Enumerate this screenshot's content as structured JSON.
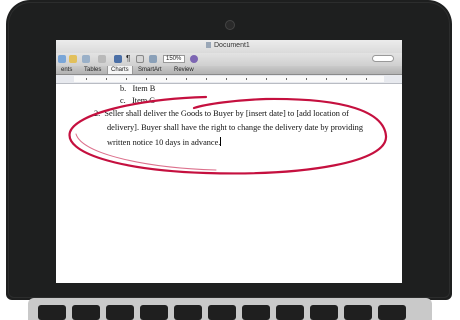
{
  "window": {
    "title": "Document1"
  },
  "toolbar": {
    "zoom": "150%"
  },
  "ribbon": {
    "tabs": [
      "ents",
      "Tables",
      "Charts",
      "SmartArt",
      "Review"
    ]
  },
  "document": {
    "lines": [
      {
        "marker": "b.",
        "text": "Item B"
      },
      {
        "marker": "c.",
        "text": "Item C"
      },
      {
        "marker": "2.",
        "text": "Seller shall deliver the Goods to Buyer by [insert date] to [add location of"
      },
      {
        "marker": "",
        "text": "delivery]. Buyer shall have the right to change the delivery date by providing"
      },
      {
        "marker": "",
        "text": "written notice 10 days in advance."
      }
    ]
  },
  "colors": {
    "annotation": "#c5103f",
    "bezel": "#1e1f1f"
  }
}
